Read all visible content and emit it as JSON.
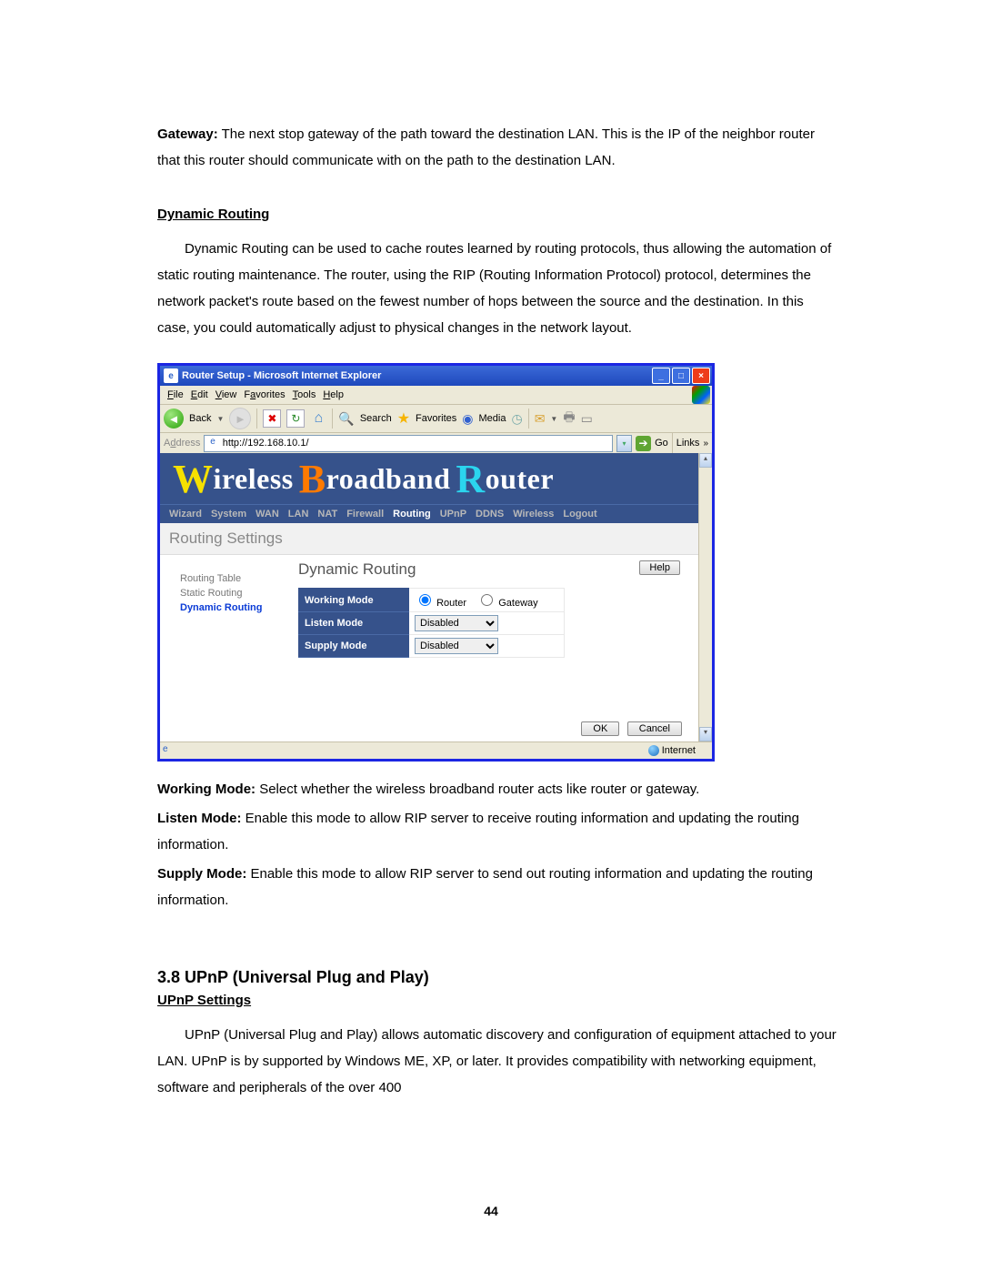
{
  "intro": {
    "gateway_label": "Gateway:",
    "gateway_text": " The next stop gateway of the path toward the destination LAN. This is the IP of the neighbor router that this router should communicate with on the path to the destination LAN."
  },
  "dyn": {
    "heading": "Dynamic Routing",
    "text": "Dynamic Routing can be used to cache routes learned by routing protocols, thus allowing the automation of static routing maintenance. The router, using the RIP (Routing Information Protocol) protocol, determines the network packet's route based on the fewest number of hops between the source and the destination. In this case, you could automatically adjust to physical changes in the network layout."
  },
  "ie": {
    "title": "Router Setup - Microsoft Internet Explorer",
    "menu": {
      "file": "File",
      "edit": "Edit",
      "view": "View",
      "favorites": "Favorites",
      "tools": "Tools",
      "help": "Help"
    },
    "toolbar": {
      "back": "Back",
      "search": "Search",
      "favorites": "Favorites",
      "media": "Media"
    },
    "address_label": "Address",
    "url": "http://192.168.10.1/",
    "go": "Go",
    "links": "Links",
    "zone": "Internet"
  },
  "router": {
    "brand": {
      "w": "W",
      "ireless": "ireless ",
      "b": "B",
      "roadband": "roadband ",
      "r": "R",
      "outer": "outer"
    },
    "nav": [
      "Wizard",
      "System",
      "WAN",
      "LAN",
      "NAT",
      "Firewall",
      "Routing",
      "UPnP",
      "DDNS",
      "Wireless",
      "Logout"
    ],
    "nav_active": "Routing",
    "section": "Routing Settings",
    "side": {
      "rt": "Routing Table",
      "sr": "Static Routing",
      "dr": "Dynamic Routing"
    },
    "pane_title": "Dynamic Routing",
    "help": "Help",
    "rows": {
      "working": "Working Mode",
      "listen": "Listen Mode",
      "supply": "Supply Mode",
      "router_opt": "Router",
      "gateway_opt": "Gateway",
      "disabled": "Disabled"
    },
    "ok": "OK",
    "cancel": "Cancel"
  },
  "expl": {
    "wm_label": "Working Mode:",
    "wm_text": " Select whether the wireless broadband router acts like router or gateway.",
    "lm_label": "Listen Mode:",
    "lm_text": " Enable this mode to allow RIP server to receive routing information and updating the routing information.",
    "sm_label": "Supply Mode:",
    "sm_text": " Enable this mode to allow RIP server to send out routing information and updating the routing information."
  },
  "upnp": {
    "heading": "3.8    UPnP (Universal Plug and Play)",
    "sub": "UPnP Settings",
    "text": "UPnP (Universal Plug and Play) allows automatic discovery and configuration of equipment attached to your LAN. UPnP is by supported by Windows ME, XP, or later. It provides compatibility with networking equipment, software and peripherals of the over 400"
  },
  "page_number": "44"
}
